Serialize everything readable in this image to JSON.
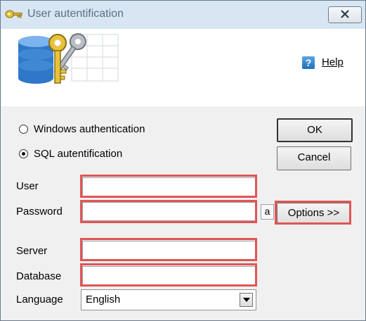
{
  "window": {
    "title": "User autentification"
  },
  "header": {
    "help_label": "Help",
    "help_icon": "help-icon"
  },
  "auth": {
    "windows_label": "Windows authentication",
    "sql_label": "SQL autentification",
    "selected": "sql"
  },
  "buttons": {
    "ok": "OK",
    "cancel": "Cancel",
    "options": "Options >>",
    "a": "a"
  },
  "fields": {
    "user": {
      "label": "User",
      "value": ""
    },
    "password": {
      "label": "Password",
      "value": ""
    },
    "server": {
      "label": "Server",
      "value": ""
    },
    "database": {
      "label": "Database",
      "value": ""
    },
    "language": {
      "label": "Language",
      "value": "English"
    }
  },
  "colors": {
    "highlight": "#e05555",
    "titlebar": "#d8e5f2",
    "dialog_bg": "#f0f0f0"
  }
}
